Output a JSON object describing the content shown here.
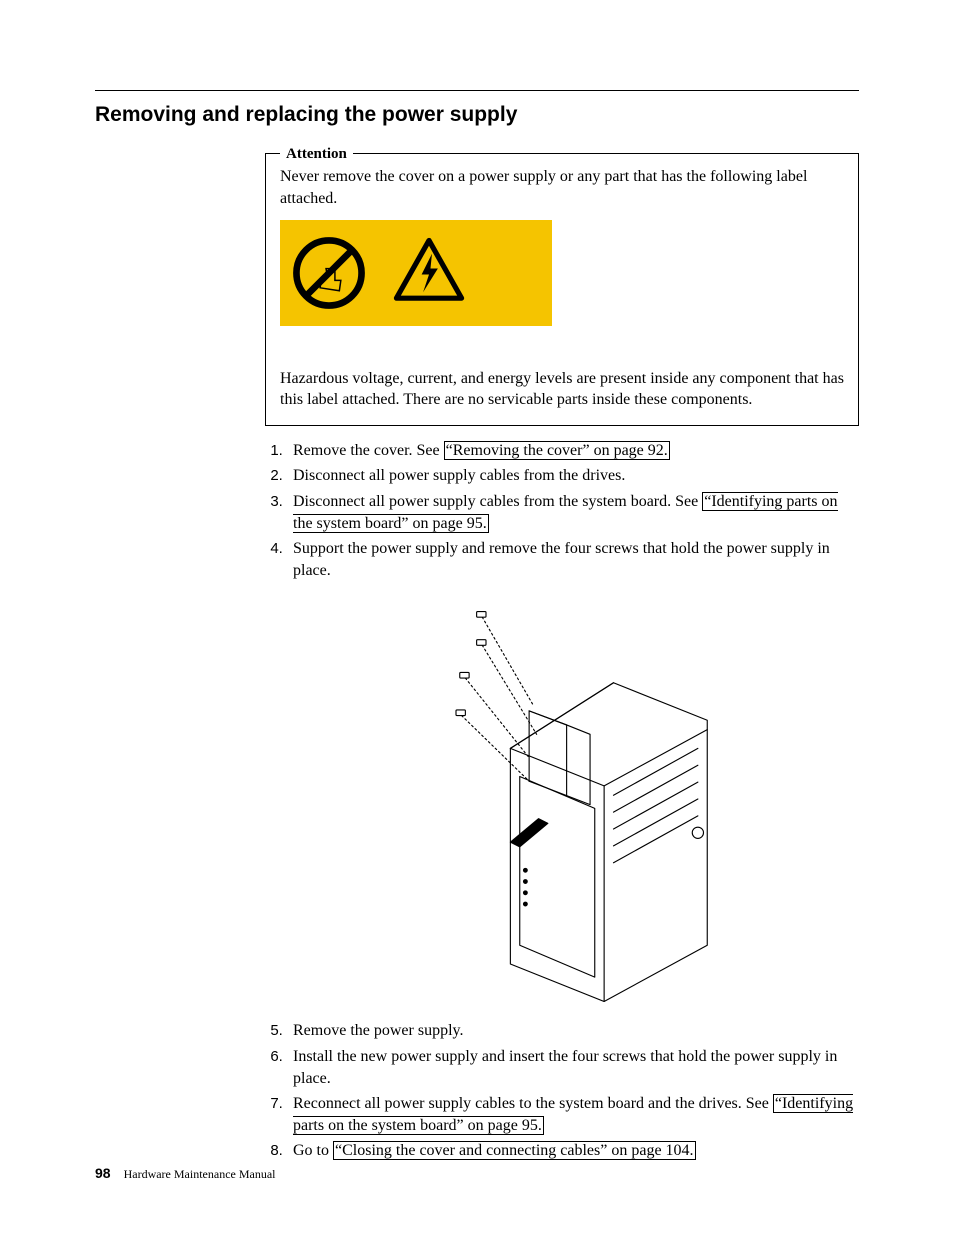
{
  "heading": "Removing and replacing the power supply",
  "attention": {
    "legend": "Attention",
    "intro": "Never remove the cover on a power supply or any part that has the following label attached.",
    "hazard": "Hazardous voltage, current, and energy levels are present inside any component that has this label attached. There are no servicable parts inside these components."
  },
  "steps": {
    "s1_pre": "Remove the cover. See ",
    "s1_link": "“Removing the cover” on page 92.",
    "s2": "Disconnect all power supply cables from the drives.",
    "s3_pre": "Disconnect all power supply cables from the system board. See ",
    "s3_link": "“Identifying parts on the system board” on page 95.",
    "s4": "Support the power supply and remove the four screws that hold the power supply in place.",
    "s5": "Remove the power supply.",
    "s6": "Install the new power supply and insert the four screws that hold the power supply in place.",
    "s7_pre": "Reconnect all power supply cables to the system board and the drives. See ",
    "s7_link": "“Identifying parts on the system board” on page 95.",
    "s8_pre": "Go to ",
    "s8_link": "“Closing the cover and connecting cables” on page 104."
  },
  "footer": {
    "page_number": "98",
    "book_title": "Hardware Maintenance Manual"
  }
}
